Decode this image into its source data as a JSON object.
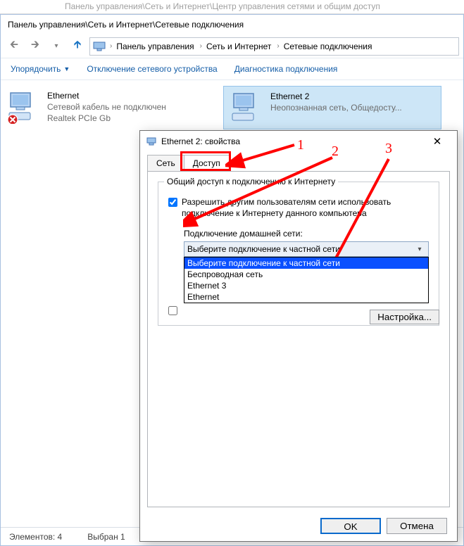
{
  "parent_title": "Панель управления\\Сеть и Интернет\\Центр управления сетями и общим доступ",
  "explorer": {
    "title_path": "Панель управления\\Сеть и Интернет\\Сетевые подключения",
    "breadcrumbs": [
      "Панель управления",
      "Сеть и Интернет",
      "Сетевые подключения"
    ],
    "commands": {
      "organize": "Упорядочить",
      "disable": "Отключение сетевого устройства",
      "diagnose": "Диагностика подключения"
    },
    "connections": [
      {
        "name": "Ethernet",
        "line2": "Сетевой кабель не подключен",
        "line3": "Realtek PCIe Gb",
        "error": true
      },
      {
        "name": "Ethernet 2",
        "line2": "Неопознанная сеть, Общедосту...",
        "line3": "",
        "error": false
      }
    ],
    "status": {
      "items": "Элементов: 4",
      "selected": "Выбран 1"
    }
  },
  "dialog": {
    "title": "Ethernet 2: свойства",
    "tabs": {
      "network": "Сеть",
      "sharing": "Доступ"
    },
    "group_title": "Общий доступ к подключению к Интернету",
    "allow_label": "Разрешить другим пользователям сети использовать подключение к Интернету данного компьютера",
    "home_net_label": "Подключение домашней сети:",
    "combo_value": "Выберите подключение к частной сети",
    "combo_options": [
      "Выберите подключение к частной сети",
      "Беспроводная сеть",
      "Ethernet 3",
      "Ethernet"
    ],
    "other_checkbox": "",
    "settings_btn": "Настройка...",
    "ok": "OK",
    "cancel": "Отмена"
  },
  "annotations": {
    "n1": "1",
    "n2": "2",
    "n3": "3"
  }
}
